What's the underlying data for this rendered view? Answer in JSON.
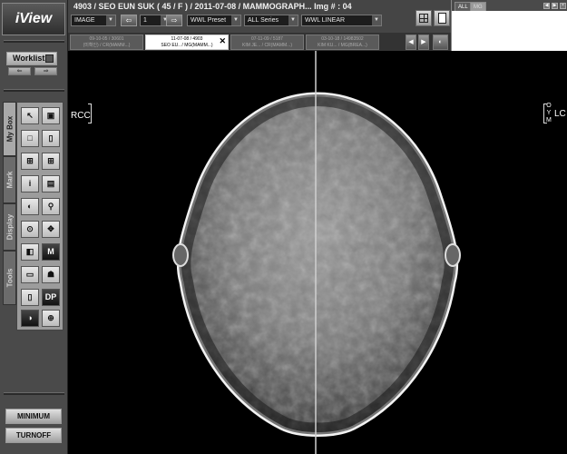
{
  "app": {
    "logo_text": "iView"
  },
  "sidebar": {
    "worklist_label": "Worklist",
    "tabs": [
      "My Box",
      "Mark",
      "Display",
      "Tools"
    ],
    "tool_buttons": [
      {
        "name": "pointer-tool-icon",
        "glyph": "↖"
      },
      {
        "name": "save-tool-icon",
        "glyph": "▣"
      },
      {
        "name": "layout-1x1-icon",
        "glyph": "□"
      },
      {
        "name": "layout-1x2-icon",
        "glyph": "▯"
      },
      {
        "name": "layout-2x2-icon",
        "glyph": "⊞"
      },
      {
        "name": "layout-3x3-icon",
        "glyph": "⊞"
      },
      {
        "name": "info-icon",
        "glyph": "i"
      },
      {
        "name": "report-icon",
        "glyph": "▤"
      },
      {
        "name": "window-level-icon",
        "glyph": "◐"
      },
      {
        "name": "zoom-icon",
        "glyph": "⚲"
      },
      {
        "name": "magnify-icon",
        "glyph": "⊙"
      },
      {
        "name": "pan-icon",
        "glyph": "✥"
      },
      {
        "name": "flip-icon",
        "glyph": "◧"
      },
      {
        "name": "marker-icon",
        "glyph": "M"
      },
      {
        "name": "ruler-icon",
        "glyph": "▭"
      },
      {
        "name": "annotation-icon",
        "glyph": "☗"
      },
      {
        "name": "compare-icon",
        "glyph": "▯"
      },
      {
        "name": "dicom-icon",
        "glyph": "DP"
      },
      {
        "name": "invert-icon",
        "glyph": "◑"
      },
      {
        "name": "reset-icon",
        "glyph": "⊕"
      }
    ],
    "minimum_label": "MINIMUM",
    "turnoff_label": "TURNOFF"
  },
  "header": {
    "patient_line": "4903  /  SEO EUN SUK ( 45  /  F )  /  2011-07-08  /  MAMMOGRAPH...   Img # : 04",
    "controls": {
      "mode": "IMAGE",
      "page": "1",
      "wwl_preset": "WWL Preset",
      "series": "ALL Series",
      "wwl_mode": "WWL LINEAR"
    }
  },
  "right_panel": {
    "tabs": [
      "ALL",
      "MG"
    ]
  },
  "study_tabs": [
    {
      "line1": "09-10-05 / 30601",
      "line2": "(미확인) / CR(MAMM...)",
      "active": false
    },
    {
      "line1": "11-07-08 / 4903",
      "line2": "SEO EU.. / MG(MAMM...)",
      "active": true
    },
    {
      "line1": "07-11-09 / 5187",
      "line2": "KIM JE... / CR(MAMM...)",
      "active": false
    },
    {
      "line1": "03-10-18 / 14983502",
      "line2": "KIM KU... / MG(BREA...)",
      "active": false
    }
  ],
  "viewer": {
    "left_label": "RCC",
    "right_label": "LC",
    "right_letters": [
      "O",
      "Y",
      "M"
    ]
  }
}
